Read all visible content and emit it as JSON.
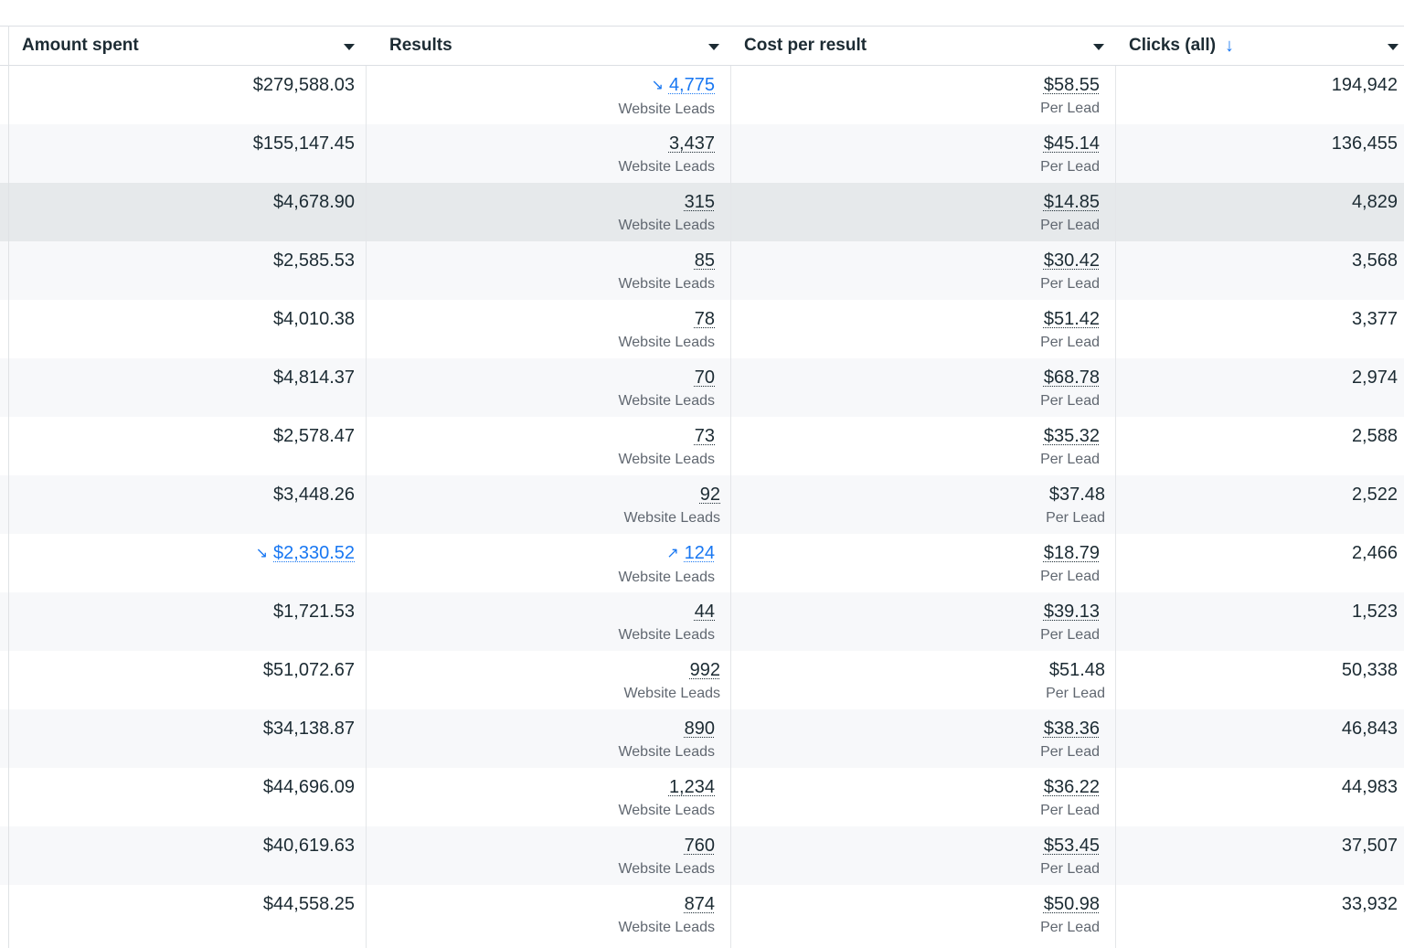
{
  "columns": {
    "amount_spent": "Amount spent",
    "results": "Results",
    "cost_per_result": "Cost per result",
    "clicks_all": "Clicks (all)"
  },
  "icons": {
    "sort": "arrow-down-icon",
    "dropdown": "caret-down-icon",
    "trend_down": "trend-down-icon",
    "trend_up": "trend-up-icon"
  },
  "accent_color": "#1877f2",
  "rows": [
    {
      "amount": "$279,588.03",
      "results": "4,775",
      "results_label": "Website Leads",
      "cpr": "$58.55",
      "cpr_label": "Per Lead",
      "clicks": "194,942"
    },
    {
      "amount": "$155,147.45",
      "results": "3,437",
      "results_label": "Website Leads",
      "cpr": "$45.14",
      "cpr_label": "Per Lead",
      "clicks": "136,455"
    },
    {
      "amount": "$4,678.90",
      "results": "315",
      "results_label": "Website Leads",
      "cpr": "$14.85",
      "cpr_label": "Per Lead",
      "clicks": "4,829"
    },
    {
      "amount": "$2,585.53",
      "results": "85",
      "results_label": "Website Leads",
      "cpr": "$30.42",
      "cpr_label": "Per Lead",
      "clicks": "3,568"
    },
    {
      "amount": "$4,010.38",
      "results": "78",
      "results_label": "Website Leads",
      "cpr": "$51.42",
      "cpr_label": "Per Lead",
      "clicks": "3,377"
    },
    {
      "amount": "$4,814.37",
      "results": "70",
      "results_label": "Website Leads",
      "cpr": "$68.78",
      "cpr_label": "Per Lead",
      "clicks": "2,974"
    },
    {
      "amount": "$2,578.47",
      "results": "73",
      "results_label": "Website Leads",
      "cpr": "$35.32",
      "cpr_label": "Per Lead",
      "clicks": "2,588"
    },
    {
      "amount": "$3,448.26",
      "results": "92",
      "results_label": "Website Leads",
      "cpr": "$37.48",
      "cpr_label": "Per Lead",
      "clicks": "2,522"
    },
    {
      "amount": "$2,330.52",
      "results": "124",
      "results_label": "Website Leads",
      "cpr": "$18.79",
      "cpr_label": "Per Lead",
      "clicks": "2,466"
    },
    {
      "amount": "$1,721.53",
      "results": "44",
      "results_label": "Website Leads",
      "cpr": "$39.13",
      "cpr_label": "Per Lead",
      "clicks": "1,523"
    },
    {
      "amount": "$51,072.67",
      "results": "992",
      "results_label": "Website Leads",
      "cpr": "$51.48",
      "cpr_label": "Per Lead",
      "clicks": "50,338"
    },
    {
      "amount": "$34,138.87",
      "results": "890",
      "results_label": "Website Leads",
      "cpr": "$38.36",
      "cpr_label": "Per Lead",
      "clicks": "46,843"
    },
    {
      "amount": "$44,696.09",
      "results": "1,234",
      "results_label": "Website Leads",
      "cpr": "$36.22",
      "cpr_label": "Per Lead",
      "clicks": "44,983"
    },
    {
      "amount": "$40,619.63",
      "results": "760",
      "results_label": "Website Leads",
      "cpr": "$53.45",
      "cpr_label": "Per Lead",
      "clicks": "37,507"
    },
    {
      "amount": "$44,558.25",
      "results": "874",
      "results_label": "Website Leads",
      "cpr": "$50.98",
      "cpr_label": "Per Lead",
      "clicks": "33,932"
    }
  ]
}
